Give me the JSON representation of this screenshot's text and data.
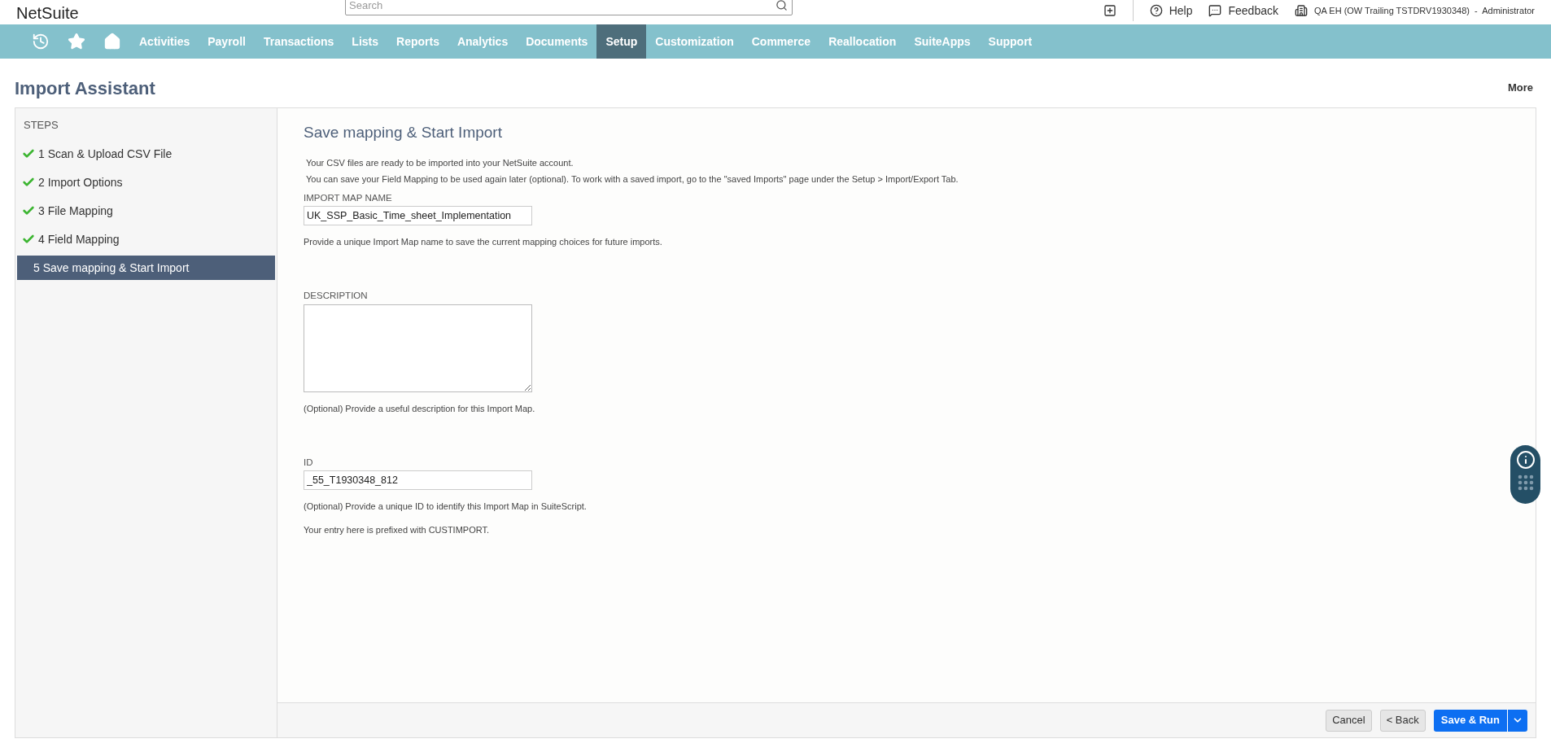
{
  "header": {
    "logo": "NetSuite",
    "search": {
      "placeholder": "Search"
    },
    "links": [
      {
        "kind": "help",
        "label": "Help"
      },
      {
        "kind": "feedback",
        "label": "Feedback"
      }
    ],
    "account": "QA EH (OW Trailing TSTDRV1930348)  -  Administrator"
  },
  "nav": [
    {
      "kind": "recent",
      "selected": false
    },
    {
      "kind": "star",
      "selected": false
    },
    {
      "kind": "home",
      "selected": false
    },
    {
      "kind": "text",
      "label": "Activities",
      "selected": false
    },
    {
      "kind": "text",
      "label": "Payroll",
      "selected": false
    },
    {
      "kind": "text",
      "label": "Transactions",
      "selected": false
    },
    {
      "kind": "text",
      "label": "Lists",
      "selected": false
    },
    {
      "kind": "text",
      "label": "Reports",
      "selected": false
    },
    {
      "kind": "text",
      "label": "Analytics",
      "selected": false
    },
    {
      "kind": "text",
      "label": "Documents",
      "selected": false
    },
    {
      "kind": "text",
      "label": "Setup",
      "selected": true
    },
    {
      "kind": "text",
      "label": "Customization",
      "selected": false
    },
    {
      "kind": "text",
      "label": "Commerce",
      "selected": false
    },
    {
      "kind": "text",
      "label": "Reallocation",
      "selected": false
    },
    {
      "kind": "text",
      "label": "SuiteApps",
      "selected": false
    },
    {
      "kind": "text",
      "label": "Support",
      "selected": false
    }
  ],
  "page": {
    "title": "Import Assistant",
    "more": "More"
  },
  "steps": {
    "heading": "STEPS",
    "items": [
      {
        "label": "1 Scan & Upload CSV File",
        "done": true,
        "selected": false
      },
      {
        "label": "2 Import Options",
        "done": true,
        "selected": false
      },
      {
        "label": "3 File Mapping",
        "done": true,
        "selected": false
      },
      {
        "label": "4 Field Mapping",
        "done": true,
        "selected": false
      },
      {
        "label": "5 Save mapping & Start Import",
        "done": false,
        "selected": true
      }
    ]
  },
  "form": {
    "title": "Save mapping & Start Import",
    "intro": [
      "Your CSV files are ready to be imported into your NetSuite account.",
      "You can save your Field Mapping to be used again later (optional). To work with a saved import, go to the \"saved Imports\" page under the Setup > Import/Export Tab."
    ],
    "fields": [
      {
        "kind": "input",
        "label": "IMPORT MAP NAME",
        "value": "UK_SSP_Basic_Time_sheet_Implementation",
        "help": [
          "Provide a unique Import Map name to save the current mapping choices for future imports."
        ]
      },
      {
        "kind": "textarea",
        "label": "DESCRIPTION",
        "help": [
          "(Optional) Provide a useful description for this Import Map."
        ]
      },
      {
        "kind": "input",
        "label": "ID",
        "value": "_55_T1930348_812",
        "help": [
          "(Optional) Provide a unique ID to identify this Import Map in SuiteScript.",
          "Your entry here is prefixed with CUSTIMPORT."
        ]
      }
    ]
  },
  "buttons": [
    {
      "kind": "plain",
      "label": "Cancel"
    },
    {
      "kind": "plain",
      "label": "< Back"
    },
    {
      "kind": "primary",
      "label": "Save & Run"
    }
  ]
}
